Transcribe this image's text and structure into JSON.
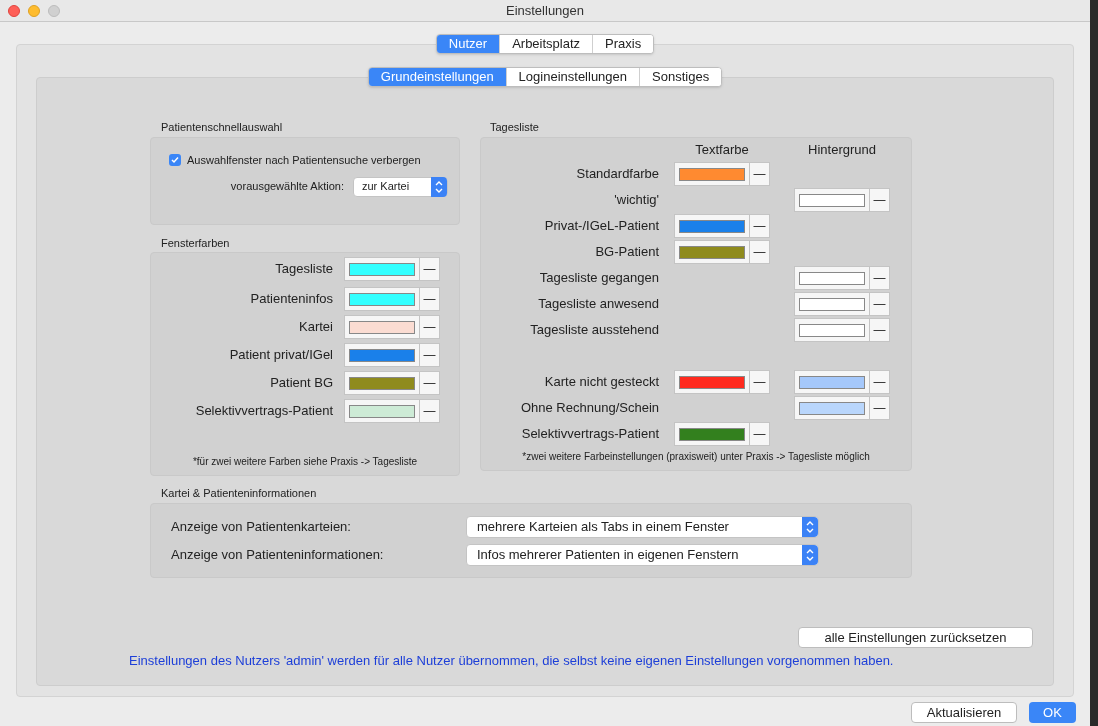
{
  "window": {
    "title": "Einstellungen"
  },
  "tabs": [
    {
      "label": "Nutzer",
      "selected": true
    },
    {
      "label": "Arbeitsplatz",
      "selected": false
    },
    {
      "label": "Praxis",
      "selected": false
    }
  ],
  "subtabs": [
    {
      "label": "Grundeinstellungen",
      "selected": true
    },
    {
      "label": "Logineinstellungen",
      "selected": false
    },
    {
      "label": "Sonstiges",
      "selected": false
    }
  ],
  "patientenschnellauswahl": {
    "title": "Patientenschnellauswahl",
    "checkbox": {
      "label": "Auswahlfenster nach Patientensuche verbergen",
      "checked": true
    },
    "action_label": "vorausgewählte Aktion:",
    "action_value": "zur Kartei"
  },
  "fensterfarben": {
    "title": "Fensterfarben",
    "minus": "—",
    "rows": [
      {
        "label": "Tagesliste",
        "color": "#33ffff"
      },
      {
        "label": "Patienteninfos",
        "color": "#33ffff"
      },
      {
        "label": "Kartei",
        "color": "#fbdcd2"
      },
      {
        "label": "Patient privat/IGel",
        "color": "#1a80ea"
      },
      {
        "label": "Patient BG",
        "color": "#8f8b1d"
      },
      {
        "label": "Selektivvertrags-Patient",
        "color": "#cdebd6"
      }
    ],
    "note": "*für zwei weitere Farben siehe Praxis -> Tagesliste"
  },
  "tagesliste": {
    "title": "Tagesliste",
    "column_headers": [
      "Textfarbe",
      "Hintergrund"
    ],
    "minus": "—",
    "groups": [
      {
        "rows": [
          {
            "label": "Standardfarbe",
            "text_well": {
              "color": "#ff8a30"
            }
          },
          {
            "label": "'wichtig'",
            "background_well": {
              "color": "#ffffff"
            }
          },
          {
            "label": "Privat-/IGeL-Patient",
            "text_well": {
              "color": "#1a80ea"
            }
          },
          {
            "label": "BG-Patient",
            "text_well": {
              "color": "#8f8b1d"
            }
          },
          {
            "label": "Tagesliste gegangen",
            "background_well": {
              "color": "#ffffff"
            }
          },
          {
            "label": "Tagesliste anwesend",
            "background_well": {
              "color": "#ffffff"
            }
          },
          {
            "label": "Tagesliste ausstehend",
            "background_well": {
              "color": "#ffffff"
            }
          }
        ]
      },
      {
        "rows": [
          {
            "label": "Karte nicht gesteckt",
            "text_well": {
              "color": "#ff2a1e"
            },
            "background_well": {
              "color": "#a5c8fb"
            }
          },
          {
            "label": "Ohne Rechnung/Schein",
            "background_well": {
              "color": "#b9d6fc"
            }
          },
          {
            "label": "Selektivvertrags-Patient",
            "text_well": {
              "color": "#33801e"
            }
          }
        ]
      }
    ],
    "note": "*zwei weitere Farbeinstellungen (praxisweit) unter Praxis -> Tagesliste möglich"
  },
  "kartei": {
    "title": "Kartei & Patienteninformationen",
    "rows": [
      {
        "label": "Anzeige von Patientenkarteien:",
        "value": "mehrere Karteien als Tabs in einem Fenster"
      },
      {
        "label": "Anzeige von Patienteninformationen:",
        "value": "Infos mehrerer Patienten in eigenen Fenstern"
      }
    ]
  },
  "reset_button": "alle Einstellungen zurücksetzen",
  "info_text": "Einstellungen des Nutzers 'admin' werden für alle Nutzer übernommen, die selbst keine eigenen Einstellungen vorgenommen haben.",
  "buttons": [
    {
      "label": "Aktualisieren",
      "default": false
    },
    {
      "label": "OK",
      "default": true
    }
  ]
}
